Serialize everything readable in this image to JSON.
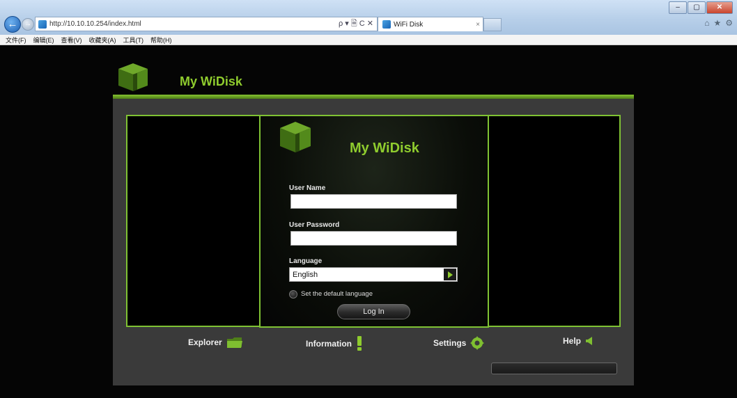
{
  "browser": {
    "url": "http://10.10.10.254/index.html",
    "address_tools": "ρ ▾ 🗎 C ✕",
    "tab_title": "WiFi Disk",
    "tab_close": "×",
    "window_controls": {
      "minimize": "–",
      "maximize": "▢",
      "close": "✕"
    },
    "right_icons": [
      "⌂",
      "★",
      "⚙"
    ],
    "menu": [
      "文件(F)",
      "编辑(E)",
      "查看(V)",
      "收藏夹(A)",
      "工具(T)",
      "帮助(H)"
    ]
  },
  "header": {
    "title": "My WiDisk"
  },
  "login": {
    "title": "My WiDisk",
    "username_label": "User Name",
    "username_value": "",
    "password_label": "User Password",
    "password_value": "",
    "language_label": "Language",
    "language_value": "English",
    "default_language_label": "Set the default language",
    "login_button": "Log In"
  },
  "nav": {
    "explorer": "Explorer",
    "information": "Information",
    "settings": "Settings",
    "help": "Help"
  },
  "colors": {
    "accent": "#8fcc2e",
    "panel_border": "#7fc233",
    "background": "#000000"
  }
}
